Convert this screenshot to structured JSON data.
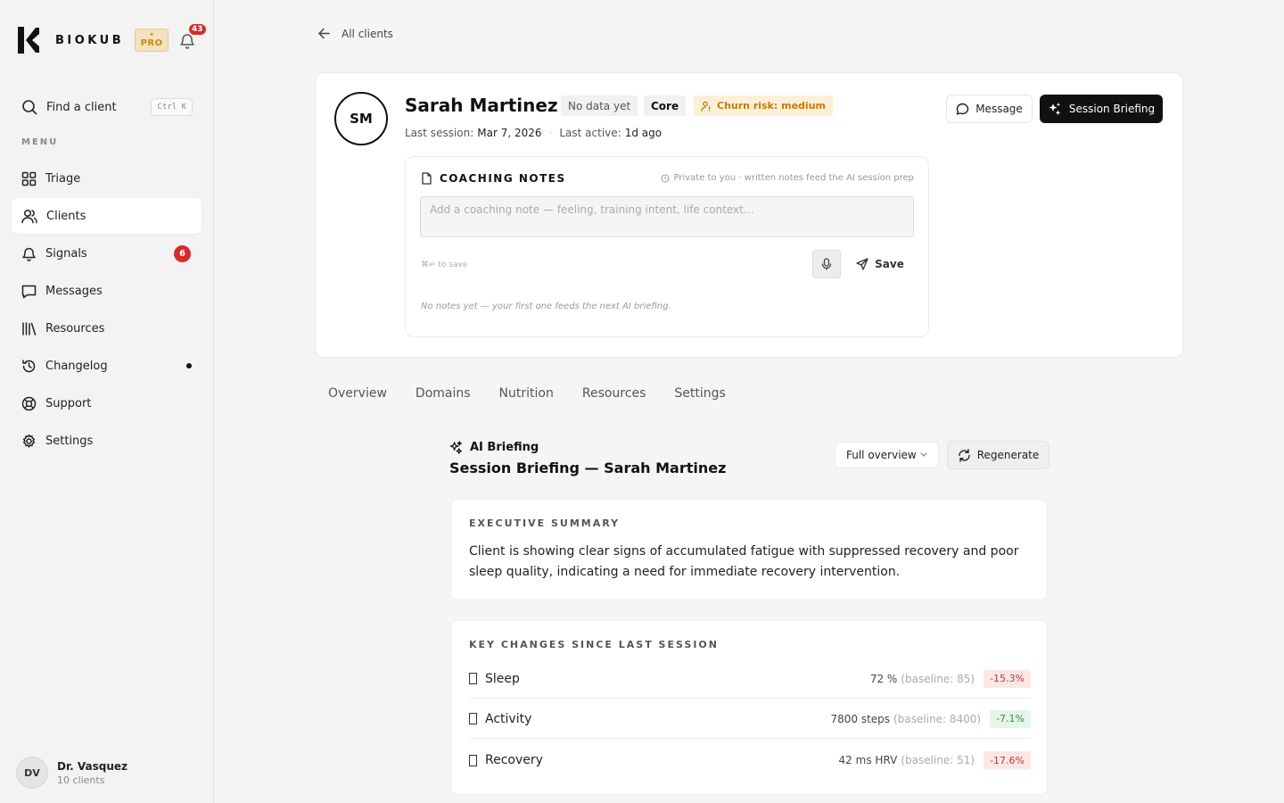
{
  "sidebar": {
    "brand_name": "BIOKUB",
    "pro_label": "PRO",
    "notification_count": "43",
    "find_label": "Find a client",
    "find_shortcut": "Ctrl K",
    "menu_label": "MENU",
    "items": [
      {
        "label": "Triage",
        "icon": "grid-icon"
      },
      {
        "label": "Clients",
        "icon": "users-icon",
        "active": true
      },
      {
        "label": "Signals",
        "icon": "bell-icon",
        "badge": "6"
      },
      {
        "label": "Messages",
        "icon": "message-icon"
      },
      {
        "label": "Resources",
        "icon": "library-icon"
      },
      {
        "label": "Changelog",
        "icon": "history-icon",
        "dot": true
      },
      {
        "label": "Support",
        "icon": "lifebuoy-icon"
      },
      {
        "label": "Settings",
        "icon": "gear-icon"
      }
    ],
    "user": {
      "initials": "DV",
      "name": "Dr. Vasquez",
      "subtitle": "10 clients"
    }
  },
  "header": {
    "back_label": "All clients"
  },
  "client": {
    "initials": "SM",
    "name": "Sarah Martinez",
    "tag_nodata": "No data yet",
    "tag_plan": "Core",
    "tag_churn": "Churn risk: medium",
    "last_session_label": "Last session:",
    "last_session_value": "Mar 7, 2026",
    "last_active_label": "Last active:",
    "last_active_value": "1d ago",
    "message_label": "Message",
    "briefing_label": "Session Briefing"
  },
  "notes": {
    "title": "COACHING NOTES",
    "private_text": "Private to you · written notes feed the AI session prep",
    "placeholder": "Add a coaching note — feeling, training intent, life context…",
    "value": "",
    "shortcut": "⌘↵ to save",
    "save_label": "Save",
    "empty_text": "No notes yet — your first one feeds the next AI briefing."
  },
  "tabs": [
    "Overview",
    "Domains",
    "Nutrition",
    "Resources",
    "Settings"
  ],
  "briefing": {
    "label": "AI Briefing",
    "title": "Session Briefing — Sarah Martinez",
    "view_select": "Full overview",
    "regenerate_label": "Regenerate",
    "summary_label": "EXECUTIVE SUMMARY",
    "summary_text": "Client is showing clear signs of accumulated fatigue with suppressed recovery and poor sleep quality, indicating a need for immediate recovery intervention.",
    "changes_label": "KEY CHANGES SINCE LAST SESSION",
    "changes": [
      {
        "name": "Sleep",
        "value": "72 %",
        "baseline": "(baseline: 85)",
        "delta": "-15.3%",
        "tone": "negative"
      },
      {
        "name": "Activity",
        "value": "7800 steps",
        "baseline": "(baseline: 8400)",
        "delta": "-7.1%",
        "tone": "positive"
      },
      {
        "name": "Recovery",
        "value": "42 ms HRV",
        "baseline": "(baseline: 51)",
        "delta": "-17.6%",
        "tone": "negative"
      }
    ]
  },
  "colors": {
    "accent": "#111111",
    "danger": "#d62b2b",
    "warning": "#c47b0a",
    "pro": "#c98a16"
  }
}
